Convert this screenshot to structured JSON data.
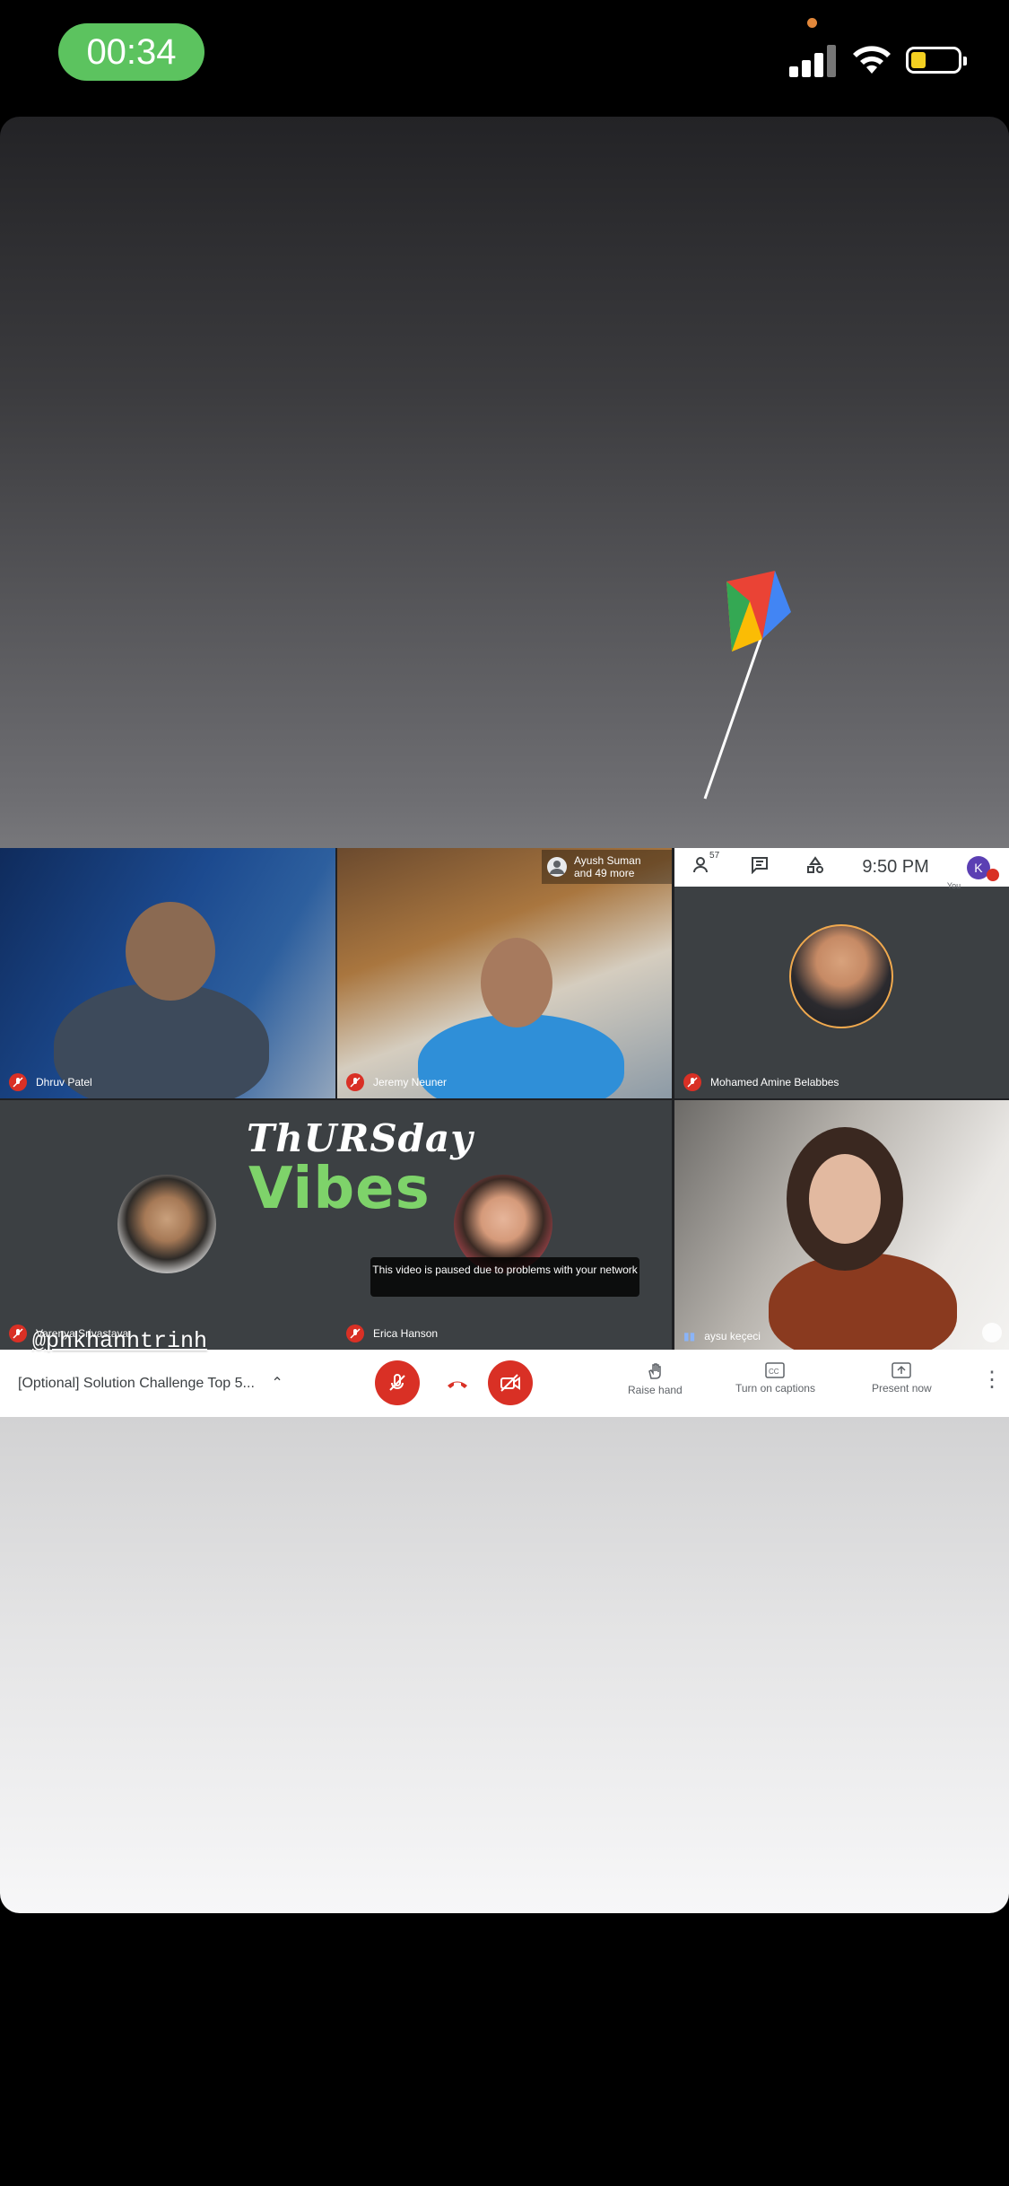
{
  "status_bar": {
    "timer": "00:34"
  },
  "meet": {
    "top_bar": {
      "time": "9:50 PM",
      "you_label": "You",
      "avatar_letter": "K",
      "people_count": "57"
    },
    "pinned_chip": {
      "line1": "Ayush Suman",
      "line2": "and 49 more"
    },
    "tiles": [
      {
        "name": "Dhruv Patel"
      },
      {
        "name": "Jeremy Neuner"
      },
      {
        "name": "Mohamed Amine Belabbes"
      },
      {
        "name": "Varenya Srivastava"
      },
      {
        "name": "Erica Hanson"
      },
      {
        "name": "aysu keçeci"
      }
    ],
    "thursday_title": "ThURSday",
    "thursday_sub": "Vibes",
    "paused_message": "This video is paused due to problems with your network",
    "meeting_title": "[Optional] Solution Challenge Top 5...",
    "controls": {
      "raise_hand": "Raise hand",
      "captions": "Turn on captions",
      "present": "Present now"
    }
  },
  "story": {
    "mention": "@phkhanhtrinh"
  },
  "colors": {
    "timer_green": "#5cc35f",
    "meet_red": "#d93025",
    "tile_bg": "#3c4043"
  }
}
